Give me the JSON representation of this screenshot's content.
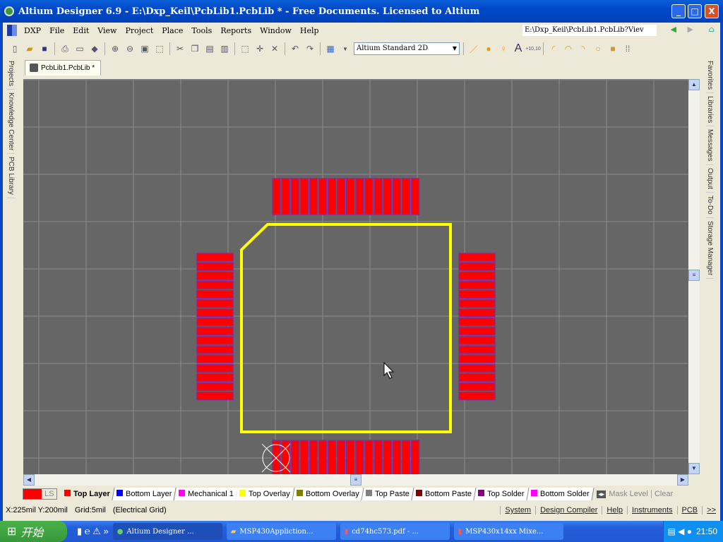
{
  "window": {
    "title": "Altium Designer 6.9 - E:\\Dxp_Keil\\PcbLib1.PcbLib * - Free Documents. Licensed to Altium",
    "minimize": "_",
    "maximize": "□",
    "close": "X"
  },
  "menu": {
    "items": [
      "DXP",
      "File",
      "Edit",
      "View",
      "Project",
      "Place",
      "Tools",
      "Reports",
      "Window",
      "Help"
    ],
    "path": "E:\\Dxp_Keil\\PcbLib1.PcbLib?Viev"
  },
  "toolbar": {
    "view_combo": "Altium Standard 2D"
  },
  "document_tab": "PcbLib1.PcbLib *",
  "left_panels": [
    "Projects",
    "Knowledge Center",
    "PCB Library"
  ],
  "right_panels": [
    "Favorites",
    "Libraries",
    "Messages",
    "Output",
    "To-Do",
    "Storage Manager"
  ],
  "footprint": {
    "pads_per_side": 16,
    "pad_color": "#ff0000",
    "pad_outline": "#8a2a8a",
    "overlay_color": "#ffff00",
    "background": "#666666",
    "grid_color": "#8c8c8c"
  },
  "layers": {
    "ls": "LS",
    "tabs": [
      {
        "label": "Top Layer",
        "color": "#ff0000",
        "active": true
      },
      {
        "label": "Bottom Layer",
        "color": "#0000ff"
      },
      {
        "label": "Mechanical 1",
        "color": "#ff00ff"
      },
      {
        "label": "Top Overlay",
        "color": "#ffff00"
      },
      {
        "label": "Bottom Overlay",
        "color": "#808000"
      },
      {
        "label": "Top Paste",
        "color": "#808080"
      },
      {
        "label": "Bottom Paste",
        "color": "#800000"
      },
      {
        "label": "Top Solder",
        "color": "#800080"
      },
      {
        "label": "Bottom Solder",
        "color": "#ff00ff"
      }
    ],
    "mask_level": "Mask Level",
    "clear": "Clear"
  },
  "status": {
    "coords": "X:225mil Y:200mil",
    "grid": "Grid:5mil",
    "grid_type": "(Electrical Grid)",
    "buttons": [
      "System",
      "Design Compiler",
      "Help",
      "Instruments",
      "PCB",
      ">>"
    ]
  },
  "taskbar": {
    "start": "开始",
    "tasks": [
      "Altium Designer ...",
      "MSP430Appliction...",
      "cd74hc573.pdf - ...",
      "MSP430x14xx Mixe..."
    ],
    "clock": "21:50"
  }
}
